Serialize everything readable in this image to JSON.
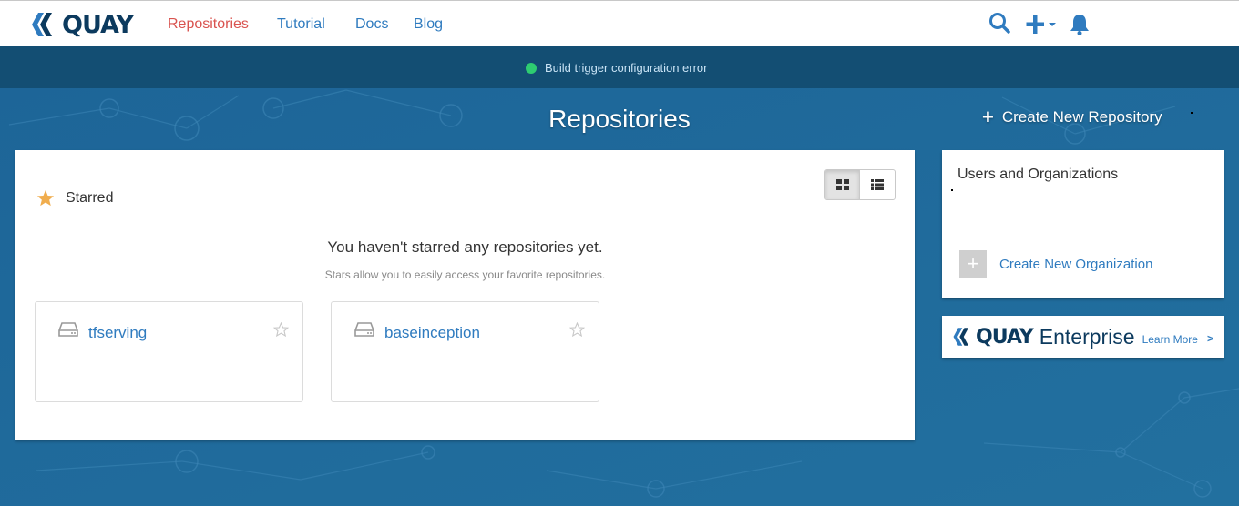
{
  "app": {
    "name": "QUAY"
  },
  "nav": {
    "links": [
      "Repositories",
      "Tutorial",
      "Docs",
      "Blog"
    ],
    "active": "Repositories",
    "icons": [
      "search-icon",
      "plus-dropdown-icon",
      "bell-icon"
    ]
  },
  "banner": {
    "status_color": "#2ecc71",
    "text": "Build trigger configuration error"
  },
  "page": {
    "title": "Repositories",
    "create_repo_label": "Create New Repository"
  },
  "starred": {
    "label": "Starred",
    "empty_title": "You haven't starred any repositories yet.",
    "empty_subtitle": "Stars allow you to easily access your favorite repositories.",
    "view_modes": [
      "grid",
      "list"
    ],
    "active_view": "grid"
  },
  "repositories": [
    {
      "name": "tfserving"
    },
    {
      "name": "baseinception"
    }
  ],
  "side": {
    "title": "Users and Organizations",
    "create_org_label": "Create New Organization"
  },
  "enterprise": {
    "brand": "QUAY",
    "word": "Enterprise",
    "learn_more": "Learn More",
    "chevron": ">"
  },
  "colors": {
    "accent": "#2f7bbf",
    "active_nav": "#d9534f",
    "logo": "#0c3a5e",
    "background": "#1e6a9d",
    "banner": "#134e73",
    "star": "#f0ad4e"
  }
}
